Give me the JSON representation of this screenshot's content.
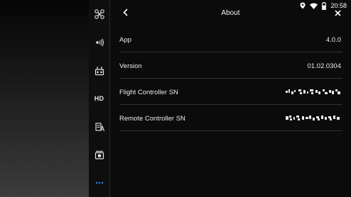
{
  "status": {
    "time": "20:58",
    "icons": [
      "location-icon",
      "wifi-icon",
      "battery-icon"
    ]
  },
  "sidebar": {
    "items": [
      {
        "name": "aircraft",
        "icon": "drone-icon"
      },
      {
        "name": "signal",
        "icon": "signal-icon"
      },
      {
        "name": "remote-controller",
        "icon": "remote-controller-icon"
      },
      {
        "name": "hd",
        "label": "HD"
      },
      {
        "name": "battery",
        "icon": "battery-settings-icon"
      },
      {
        "name": "camera",
        "icon": "camera-icon"
      },
      {
        "name": "more",
        "icon": "more-icon",
        "active": true
      }
    ],
    "active_color": "#2f8cff"
  },
  "header": {
    "title": "About"
  },
  "rows": [
    {
      "label": "App",
      "value": "4.0.0"
    },
    {
      "label": "Version",
      "value": "01.02.0304"
    },
    {
      "label": "Flight Controller SN",
      "value": null
    },
    {
      "label": "Remote Controller SN",
      "value": null
    }
  ]
}
